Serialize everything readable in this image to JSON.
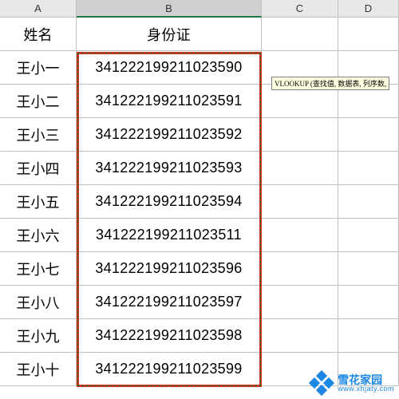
{
  "columns": {
    "A": "A",
    "B": "B",
    "C": "C",
    "D": "D"
  },
  "header": {
    "A": "姓名",
    "B": "身份证"
  },
  "rows": [
    {
      "name": "王小一",
      "id": "341222199211023590"
    },
    {
      "name": "王小二",
      "id": "341222199211023591"
    },
    {
      "name": "王小三",
      "id": "341222199211023592"
    },
    {
      "name": "王小四",
      "id": "341222199211023593"
    },
    {
      "name": "王小五",
      "id": "341222199211023594"
    },
    {
      "name": "王小六",
      "id": "341222199211023511"
    },
    {
      "name": "王小七",
      "id": "341222199211023596"
    },
    {
      "name": "王小八",
      "id": "341222199211023597"
    },
    {
      "name": "王小九",
      "id": "341222199211023598"
    },
    {
      "name": "王小十",
      "id": "341222199211023599"
    }
  ],
  "tooltip": "VLOOKUP (查找值, 数据表, 列序数,",
  "watermark": {
    "name": "雪花家园",
    "url": "www.xhjaty.com"
  },
  "selection": {
    "range_start": "B2",
    "range_end": "B11",
    "highlighted_column": "B"
  }
}
